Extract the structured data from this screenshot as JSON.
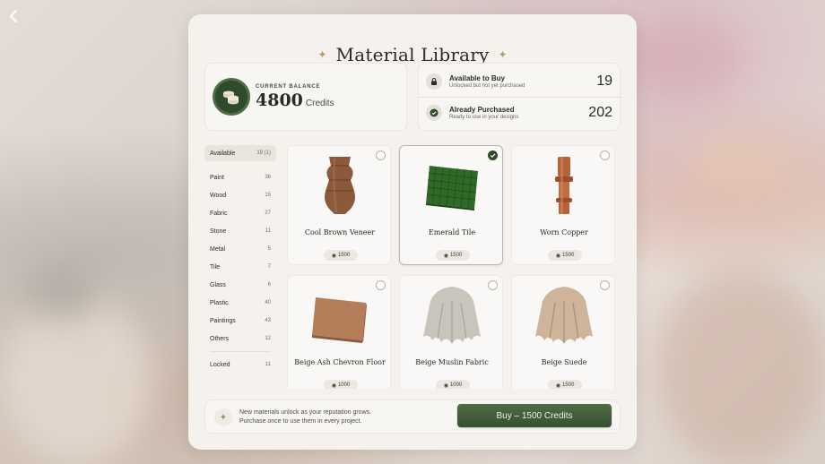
{
  "title": "Material Library",
  "balance": {
    "label": "CURRENT BALANCE",
    "value": "4800",
    "unit": "Credits"
  },
  "stats": [
    {
      "title": "Available to Buy",
      "subtitle": "Unlocked but not yet purchased",
      "count": "19",
      "icon": "lock-icon"
    },
    {
      "title": "Already Purchased",
      "subtitle": "Ready to use in your designs",
      "count": "202",
      "icon": "check-circle-icon"
    }
  ],
  "sidebar": {
    "active": {
      "label": "Available",
      "count": "19 (1)"
    },
    "items": [
      {
        "label": "Paint",
        "count": "36"
      },
      {
        "label": "Wood",
        "count": "15"
      },
      {
        "label": "Fabric",
        "count": "27"
      },
      {
        "label": "Stone",
        "count": "11"
      },
      {
        "label": "Metal",
        "count": "5"
      },
      {
        "label": "Tile",
        "count": "7"
      },
      {
        "label": "Glass",
        "count": "6"
      },
      {
        "label": "Plastic",
        "count": "40"
      },
      {
        "label": "Paintings",
        "count": "43"
      },
      {
        "label": "Others",
        "count": "12"
      }
    ],
    "locked": {
      "label": "Locked",
      "count": "11"
    }
  },
  "materials": [
    {
      "name": "Cool Brown Veneer",
      "price": "1500",
      "selected": false,
      "icon": "vase-icon",
      "color": "#8b5a3a"
    },
    {
      "name": "Emerald Tile",
      "price": "1500",
      "selected": true,
      "icon": "tile-icon",
      "color": "#2f6a26"
    },
    {
      "name": "Worn Copper",
      "price": "1500",
      "selected": false,
      "icon": "column-icon",
      "color": "#b4623a"
    },
    {
      "name": "Beige Ash Chevron Floor",
      "price": "1000",
      "selected": false,
      "icon": "board-icon",
      "color": "#b47e5a"
    },
    {
      "name": "Beige Muslin Fabric",
      "price": "1000",
      "selected": false,
      "icon": "drape-icon",
      "color": "#c9c5bd"
    },
    {
      "name": "Beige Suede",
      "price": "1500",
      "selected": false,
      "icon": "drape-icon",
      "color": "#cdb49a"
    }
  ],
  "footer": {
    "note_line1": "New materials unlock as your reputation grows.",
    "note_line2": "Purchase once to use them in every project.",
    "buy_label": "Buy – 1500 Credits"
  }
}
